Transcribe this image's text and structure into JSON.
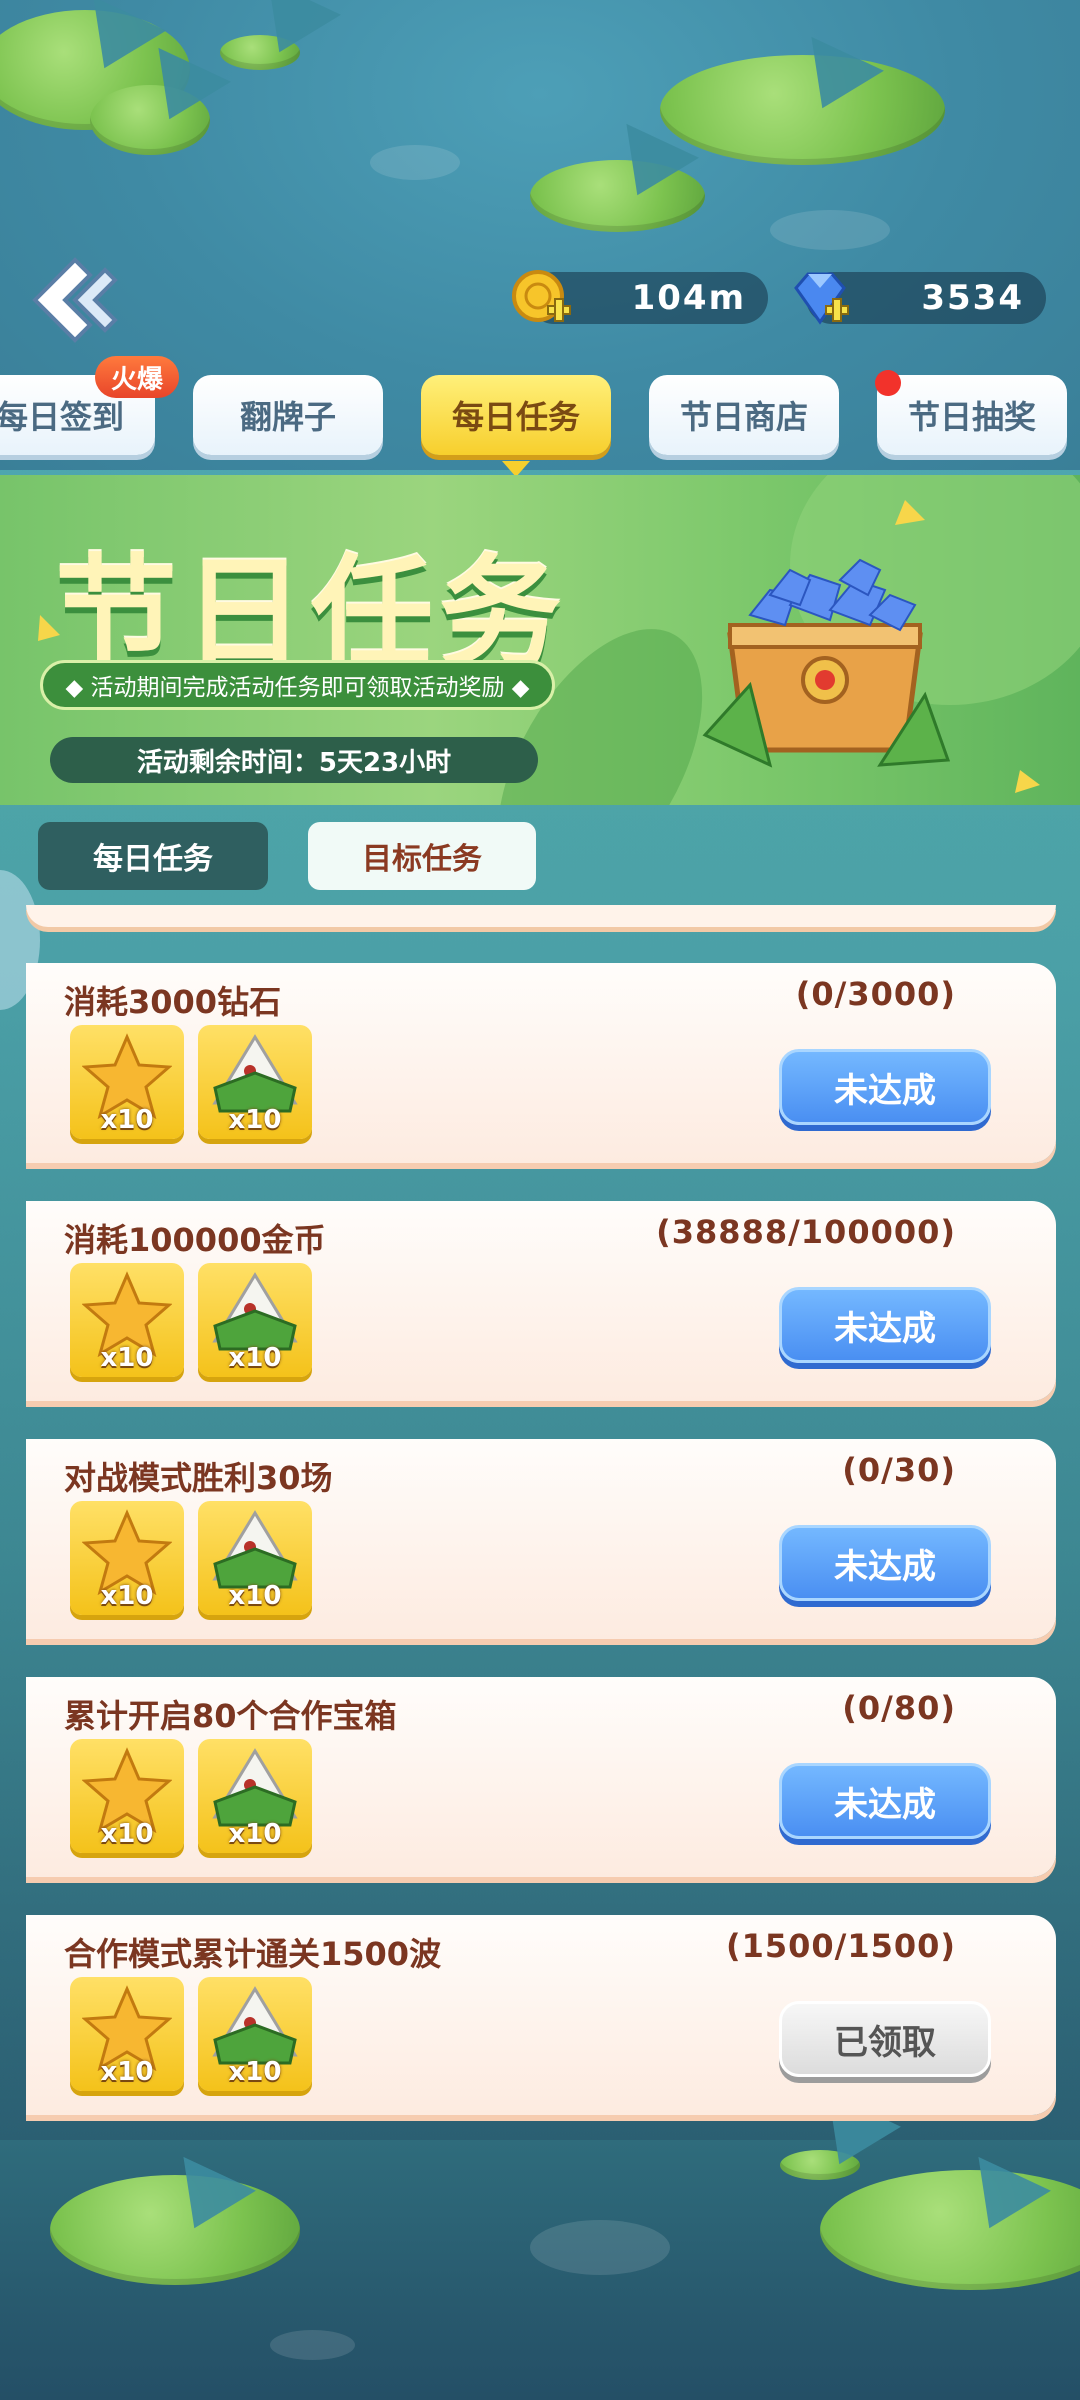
{
  "header": {
    "coins": "104m",
    "gems": "3534"
  },
  "tabs": [
    {
      "label": "每日签到",
      "badge": "火爆"
    },
    {
      "label": "翻牌子"
    },
    {
      "label": "每日任务",
      "active": true
    },
    {
      "label": "节日商店"
    },
    {
      "label": "节日抽奖"
    }
  ],
  "banner": {
    "title": "节日任务",
    "subtitle": "◆ 活动期间完成活动任务即可领取活动奖励 ◆",
    "timer": "活动剩余时间：5天23小时"
  },
  "subtabs": {
    "daily": "每日任务",
    "goal": "目标任务"
  },
  "tasks": [
    {
      "title": "消耗3000钻石",
      "progress": "(0/3000)",
      "rewards": [
        "x10",
        "x10"
      ],
      "button": "未达成",
      "status": "incomplete"
    },
    {
      "title": "消耗100000金币",
      "progress": "(38888/100000)",
      "rewards": [
        "x10",
        "x10"
      ],
      "button": "未达成",
      "status": "incomplete"
    },
    {
      "title": "对战模式胜利30场",
      "progress": "(0/30)",
      "rewards": [
        "x10",
        "x10"
      ],
      "button": "未达成",
      "status": "incomplete"
    },
    {
      "title": "累计开启80个合作宝箱",
      "progress": "(0/80)",
      "rewards": [
        "x10",
        "x10"
      ],
      "button": "未达成",
      "status": "incomplete"
    },
    {
      "title": "合作模式累计通关1500波",
      "progress": "(1500/1500)",
      "rewards": [
        "x10",
        "x10"
      ],
      "button": "已领取",
      "status": "claimed"
    }
  ],
  "colors": {
    "accent_yellow": "#f7cf2d",
    "button_blue": "#4a8ff2",
    "title_brown": "#7b3621"
  }
}
